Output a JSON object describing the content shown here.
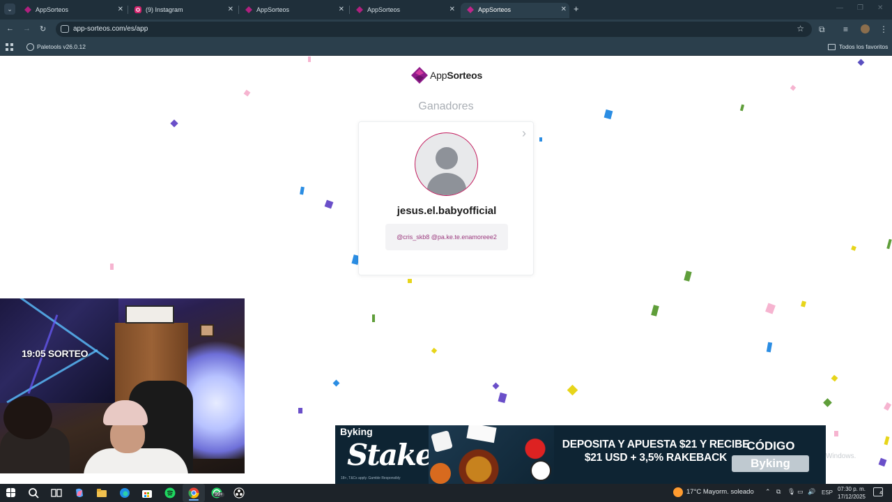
{
  "browser": {
    "tabs": [
      {
        "title": "AppSorteos",
        "favicon": "appsorteos-icon",
        "active": false
      },
      {
        "title": "(9) Instagram",
        "favicon": "instagram-icon",
        "active": false
      },
      {
        "title": "AppSorteos",
        "favicon": "appsorteos-icon",
        "active": false
      },
      {
        "title": "AppSorteos",
        "favicon": "appsorteos-icon",
        "active": false
      },
      {
        "title": "AppSorteos",
        "favicon": "appsorteos-icon",
        "active": true
      }
    ],
    "new_tab_label": "+",
    "url": "app-sorteos.com/es/app",
    "bookmarks": {
      "item": "Paletools v26.0.12",
      "all_bookmarks": "Todos los favoritos"
    }
  },
  "page": {
    "logo_light": "App",
    "logo_bold": "Sorteos",
    "section_title": "Ganadores",
    "winner": {
      "username": "jesus.el.babyofficial",
      "mentions": "@cris_skb8 @pa.ke.te.enamoreee2"
    },
    "watermark": "Windows.",
    "colors": {
      "brand": "#8e1b8a",
      "avatar_border": "#c2185b",
      "mention_text": "#9b3a7e"
    }
  },
  "webcam": {
    "overlay_text": "19:05 SORTEO"
  },
  "ad_banner": {
    "brand_tag": "Byking",
    "logo": "Stake",
    "fine_print": "18+, T&Cs apply. Gamble Responsibly",
    "headline": "DEPOSITA Y APUESTA $21 Y RECIBE $21 USD + 3,5% RAKEBACK",
    "code_label": "CÓDIGO",
    "code": "Byking"
  },
  "taskbar": {
    "whatsapp_badge": "99+",
    "weather": "17°C  Mayorm. soleado",
    "language": "ESP",
    "time": "07:30 p. m.",
    "date": "17/12/2025",
    "notification_count": "4"
  }
}
